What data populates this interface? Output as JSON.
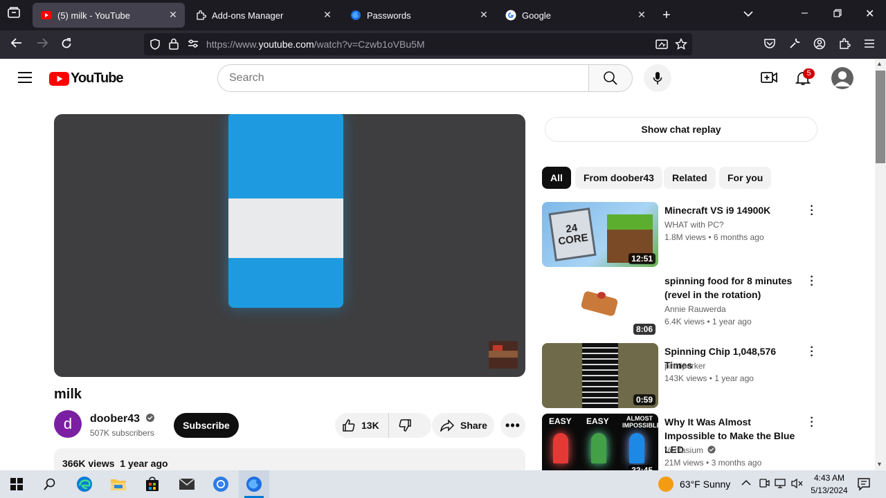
{
  "browser": {
    "tabs": [
      {
        "title": "(5) milk - YouTube",
        "active": true
      },
      {
        "title": "Add-ons Manager",
        "active": false
      },
      {
        "title": "Passwords",
        "active": false
      },
      {
        "title": "Google",
        "active": false
      }
    ],
    "url_prefix": "https://www.",
    "url_host": "youtube.com",
    "url_path": "/watch?v=Czwb1oVBu5M"
  },
  "youtube": {
    "logo_text": "YouTube",
    "search_placeholder": "Search",
    "notifications_count": "5"
  },
  "video": {
    "title": "milk",
    "channel": "doober43",
    "channel_initial": "d",
    "subscribers": "507K subscribers",
    "subscribe_label": "Subscribe",
    "likes": "13K",
    "share_label": "Share",
    "views": "366K views",
    "age": "1 year ago"
  },
  "sidebar": {
    "chat_replay_label": "Show chat replay",
    "chips": [
      "All",
      "From doober43",
      "Related",
      "For you"
    ],
    "recommendations": [
      {
        "title": "Minecraft VS i9 14900K",
        "channel": "WHAT with PC?",
        "views": "1.8M views",
        "age": "6 months ago",
        "duration": "12:51",
        "thumb_text": "24 CORE"
      },
      {
        "title": "spinning food for 8 minutes (revel in the rotation)",
        "channel": "Annie Rauwerda",
        "views": "6.4K views",
        "age": "1 year ago",
        "duration": "8:06"
      },
      {
        "title": "Spinning Chip 1,048,576 Times",
        "channel": "pinniporker",
        "views": "143K views",
        "age": "1 year ago",
        "duration": "0:59"
      },
      {
        "title": "Why It Was Almost Impossible to Make the Blue LED",
        "channel": "Veritasium",
        "views": "21M views",
        "age": "3 months ago",
        "duration": "33:45",
        "thumb_labels": [
          "EASY",
          "EASY",
          "ALMOST IMPOSSIBLE"
        ]
      }
    ]
  },
  "taskbar": {
    "weather": "63°F  Sunny",
    "time": "4:43 AM",
    "date": "5/13/2024"
  },
  "colors": {
    "yt_red": "#ff0000",
    "chrome_dark": "#1c1b22",
    "chrome_nav": "#2b2a33",
    "active_tab": "#42414d",
    "milk_blue": "#1e9be0"
  }
}
